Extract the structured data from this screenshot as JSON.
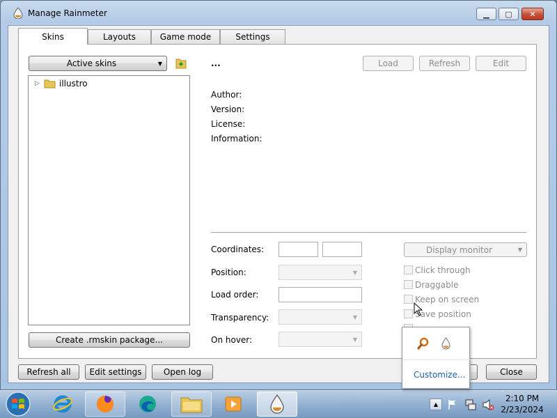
{
  "window": {
    "title": "Manage Rainmeter"
  },
  "tabs": [
    {
      "label": "Skins",
      "active": true
    },
    {
      "label": "Layouts",
      "active": false
    },
    {
      "label": "Game mode",
      "active": false
    },
    {
      "label": "Settings",
      "active": false
    }
  ],
  "skins_panel": {
    "active_skins_label": "Active skins",
    "tree_items": [
      {
        "label": "illustro",
        "icon": "folder-icon"
      }
    ],
    "create_package_label": "Create .rmskin package..."
  },
  "detail": {
    "skin_name": "...",
    "load_label": "Load",
    "refresh_label": "Refresh",
    "edit_label": "Edit",
    "author_label": "Author:",
    "version_label": "Version:",
    "license_label": "License:",
    "information_label": "Information:"
  },
  "properties": {
    "coordinates_label": "Coordinates:",
    "position_label": "Position:",
    "load_order_label": "Load order:",
    "transparency_label": "Transparency:",
    "on_hover_label": "On hover:",
    "display_monitor_label": "Display monitor",
    "checkboxes": [
      {
        "label": "Click through",
        "checked": false
      },
      {
        "label": "Draggable",
        "checked": false
      },
      {
        "label": "Keep on screen",
        "checked": false
      },
      {
        "label": "Save position",
        "checked": false
      }
    ]
  },
  "footer": {
    "refresh_all_label": "Refresh all",
    "edit_settings_label": "Edit settings",
    "open_log_label": "Open log",
    "close_label": "Close"
  },
  "popup": {
    "customize_label": "Customize..."
  },
  "taskbar": {
    "items": [
      "start-orb",
      "internet-explorer",
      "firefox",
      "edge",
      "file-explorer",
      "media-player",
      "rainmeter"
    ],
    "clock_time": "2:10 PM",
    "clock_date": "2/23/2024"
  },
  "colors": {
    "link": "#1e5fa8",
    "accent": "#3b73b9"
  }
}
